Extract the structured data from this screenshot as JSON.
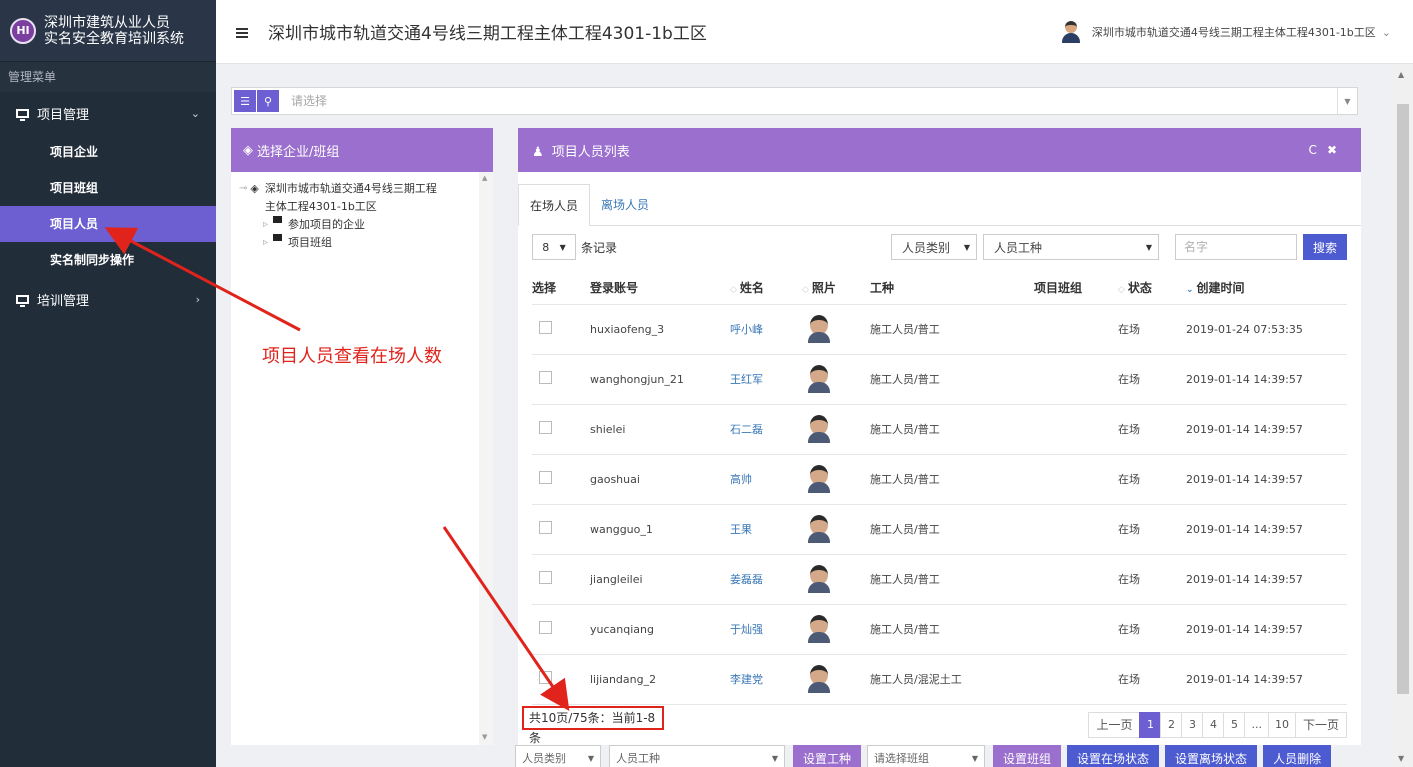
{
  "brand": {
    "logo_text": "HI",
    "line1": "深圳市建筑从业人员",
    "line2": "实名安全教育培训系统"
  },
  "sidebar": {
    "menu_title": "管理菜单",
    "groups": [
      {
        "label": "项目管理",
        "expanded": true,
        "items": [
          {
            "label": "项目企业"
          },
          {
            "label": "项目班组"
          },
          {
            "label": "项目人员",
            "active": true
          },
          {
            "label": "实名制同步操作"
          }
        ]
      },
      {
        "label": "培训管理",
        "expanded": false
      }
    ]
  },
  "header": {
    "title": "深圳市城市轨道交通4号线三期工程主体工程4301-1b工区",
    "user_label": "深圳市城市轨道交通4号线三期工程主体工程4301-1b工区"
  },
  "select_bar": {
    "placeholder": "请选择"
  },
  "left_panel": {
    "title": "选择企业/班组",
    "tree": {
      "root_line1": "深圳市城市轨道交通4号线三期工程",
      "root_line2": "主体工程4301-1b工区",
      "children": [
        "参加项目的企业",
        "项目班组"
      ]
    }
  },
  "right_panel": {
    "title": "项目人员列表",
    "tabs": [
      {
        "label": "在场人员",
        "active": true
      },
      {
        "label": "离场人员",
        "active": false
      }
    ],
    "toolbar": {
      "page_size": "8",
      "records_label": "条记录",
      "person_type": "人员类别",
      "work_type": "人员工种",
      "name_placeholder": "名字",
      "search_label": "搜索"
    },
    "columns": [
      "选择",
      "登录账号",
      "姓名",
      "照片",
      "工种",
      "项目班组",
      "状态",
      "创建时间"
    ],
    "rows": [
      {
        "account": "huxiaofeng_3",
        "name": "呼小峰",
        "work": "施工人员/普工",
        "team": "",
        "status": "在场",
        "created": "2019-01-24 07:53:35"
      },
      {
        "account": "wanghongjun_21",
        "name": "王红军",
        "work": "施工人员/普工",
        "team": "",
        "status": "在场",
        "created": "2019-01-14 14:39:57"
      },
      {
        "account": "shielei",
        "name": "石二磊",
        "work": "施工人员/普工",
        "team": "",
        "status": "在场",
        "created": "2019-01-14 14:39:57"
      },
      {
        "account": "gaoshuai",
        "name": "高帅",
        "work": "施工人员/普工",
        "team": "",
        "status": "在场",
        "created": "2019-01-14 14:39:57"
      },
      {
        "account": "wangguo_1",
        "name": "王果",
        "work": "施工人员/普工",
        "team": "",
        "status": "在场",
        "created": "2019-01-14 14:39:57"
      },
      {
        "account": "jiangleilei",
        "name": "姜磊磊",
        "work": "施工人员/普工",
        "team": "",
        "status": "在场",
        "created": "2019-01-14 14:39:57"
      },
      {
        "account": "yucanqiang",
        "name": "于灿强",
        "work": "施工人员/普工",
        "team": "",
        "status": "在场",
        "created": "2019-01-14 14:39:57"
      },
      {
        "account": "lijiandang_2",
        "name": "李建党",
        "work": "施工人员/混泥土工",
        "team": "",
        "status": "在场",
        "created": "2019-01-14 14:39:57"
      }
    ],
    "footer_info": "共10页/75条：当前1-8 条",
    "pager": {
      "prev": "上一页",
      "pages": [
        "1",
        "2",
        "3",
        "4",
        "5",
        "...",
        "10"
      ],
      "current": "1",
      "next": "下一页"
    }
  },
  "bottom_bar": {
    "person_type": "人员类别",
    "work_type": "人员工种",
    "set_work": "设置工种",
    "team_placeholder": "请选择班组",
    "set_team": "设置班组",
    "set_onsite": "设置在场状态",
    "set_offsite": "设置离场状态",
    "delete": "人员删除"
  },
  "annotation": {
    "text": "项目人员查看在场人数",
    "color": "#e0241c"
  },
  "colors": {
    "sidebar_bg": "#222d3a",
    "accent_purple": "#9b6fce",
    "active_item": "#6d5ed1",
    "button_blue": "#4d5bd1",
    "link_blue": "#3a78b7"
  }
}
